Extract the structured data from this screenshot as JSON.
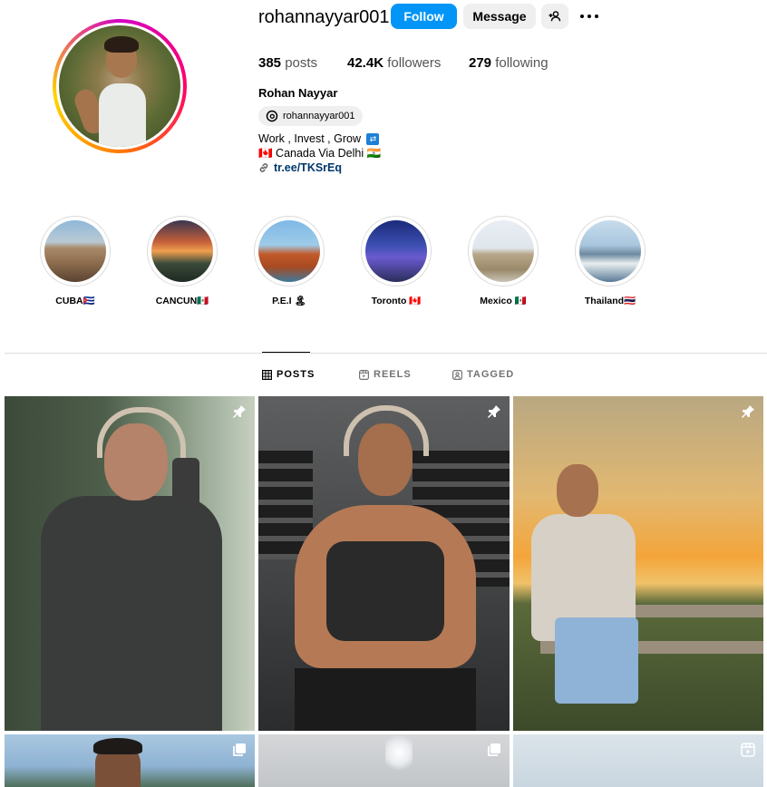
{
  "profile": {
    "username": "rohannayyar001",
    "full_name": "Rohan Nayyar",
    "threads_handle": "rohannayyar001",
    "bio_line1": "Work , Invest , Grow",
    "bio_line1_emoji": "⇄",
    "bio_line2": "🇨🇦 Canada Via Delhi 🇮🇳",
    "link": "tr.ee/TKSrEq"
  },
  "actions": {
    "follow": "Follow",
    "message": "Message"
  },
  "stats": {
    "posts_count": "385",
    "posts_label": "posts",
    "followers_count": "42.4K",
    "followers_label": "followers",
    "following_count": "279",
    "following_label": "following"
  },
  "highlights": [
    {
      "label": "CUBA🇨🇺"
    },
    {
      "label": "CANCUN🇲🇽"
    },
    {
      "label": "P.E.I 🏝"
    },
    {
      "label": "Toronto 🇨🇦"
    },
    {
      "label": "Mexico 🇲🇽"
    },
    {
      "label": "Thailand🇹🇭"
    }
  ],
  "tabs": {
    "posts": "POSTS",
    "reels": "REELS",
    "tagged": "TAGGED"
  },
  "icons": {
    "more": "more-horizontal-icon",
    "add_user": "add-user-icon",
    "threads": "threads-icon",
    "link": "link-icon",
    "pin": "pin-icon",
    "carousel": "carousel-icon",
    "reel": "reel-icon",
    "grid": "grid-icon",
    "tagged": "tagged-icon"
  },
  "colors": {
    "follow_button": "#0095f6",
    "secondary_button": "#efefef",
    "link_text": "#00376b"
  }
}
